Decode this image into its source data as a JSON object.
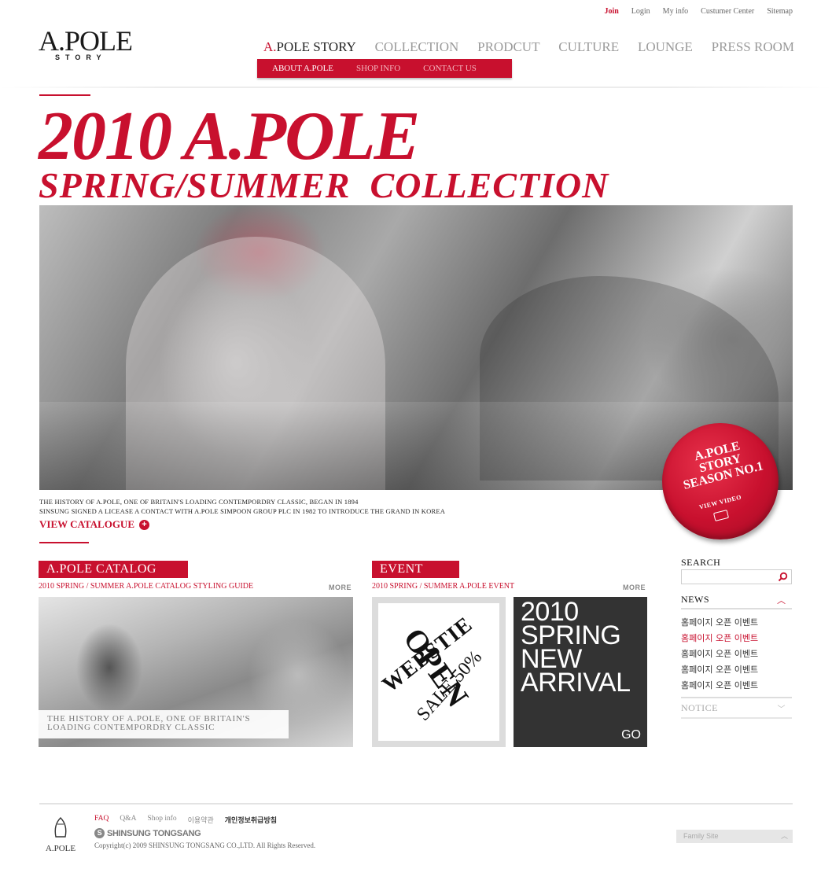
{
  "utility_nav": [
    "Join",
    "Login",
    "My info",
    "Custumer Center",
    "Sitemap"
  ],
  "logo": {
    "main": "A.POLE",
    "sub": "STORY"
  },
  "main_nav": {
    "active": {
      "accent": "A.",
      "rest": "POLE STORY"
    },
    "items": [
      "COLLECTION",
      "PRODCUT",
      "CULTURE",
      "LOUNGE",
      "PRESS ROOM"
    ]
  },
  "sub_nav": [
    "ABOUT A.POLE",
    "SHOP INFO",
    "CONTACT US"
  ],
  "hero": {
    "title_line1": "2010 A.POLE",
    "title_line2": "SPRING/SUMMER  COLLECTION",
    "caption_line1": "THE HISTORY OF A.POLE, ONE OF BRITAIN'S LOADING CONTEMPORDRY CLASSIC, BEGAN IN 1894",
    "caption_line2": "SINSUNG SIGNED A LICEASE A CONTACT WITH A.POLE SIMPOON GROUP PLC IN 1982 TO INTRODUCE THE GRAND IN KOREA",
    "view_catalogue": "VIEW CATALOGUE"
  },
  "badge": {
    "line1": "A.POLE",
    "line2": "STORY",
    "line3": "SEASON NO.1",
    "video": "VIEW VIDEO"
  },
  "catalog": {
    "tag": "A.POLE CATALOG",
    "subtitle": "2010 SPRING / SUMMER A.POLE CATALOG STYLING GUIDE",
    "more": "MORE",
    "caption_line1": "THE HISTORY OF A.POLE, ONE OF BRITAIN'S",
    "caption_line2": "LOADING CONTEMPORDRY CLASSIC"
  },
  "event": {
    "tag": "EVENT",
    "subtitle": "2010 SPRING / SUMMER A.POLE EVENT",
    "more": "MORE",
    "left_words": [
      "WEBSTIE",
      "OPEN",
      "SALE 50%"
    ],
    "right_lines": [
      "2010",
      "SPRING",
      "NEW",
      "ARRIVAL"
    ],
    "go": "GO"
  },
  "sidebar": {
    "search_label": "SEARCH",
    "search_value": "",
    "news_label": "NEWS",
    "news_items": [
      "홈페이지 오픈 이벤트",
      "홈페이지 오픈 이벤트",
      "홈페이지 오픈 이벤트",
      "홈페이지 오픈 이벤트",
      "홈페이지 오픈 이벤트"
    ],
    "notice_label": "NOTICE"
  },
  "footer": {
    "links": [
      "FAQ",
      "Q&A",
      "Shop info",
      "이용약관",
      "개인정보취급방침"
    ],
    "brand": "SHINSUNG TONGSANG",
    "copyright": "Copyright(c) 2009 SHINSUNG TONGSANG CO.,LTD. All Rights Reserved.",
    "logo_name": "A.POLE",
    "family_site": "Family Site"
  },
  "colors": {
    "accent": "#c8102e",
    "dark_tile": "#333333",
    "light_gray": "#e6e6e6"
  }
}
